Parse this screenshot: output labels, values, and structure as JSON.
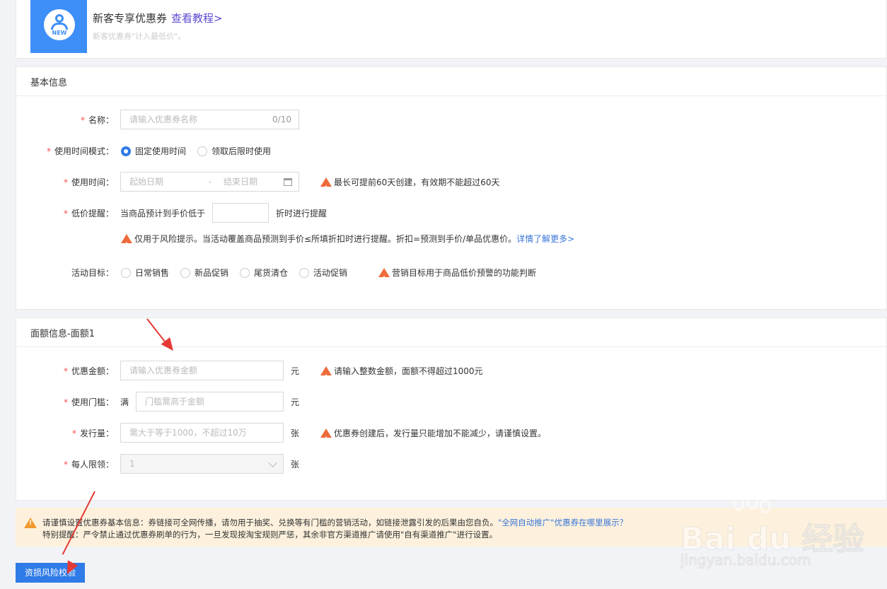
{
  "promo": {
    "badge_text": "NEW",
    "title": "新客专享优惠券",
    "tutorial_link": "查看教程>",
    "subtitle": "新客优惠券\"计入最低价\"。"
  },
  "basic": {
    "title": "基本信息",
    "name": {
      "label": "名称：",
      "placeholder": "请输入优惠券名称",
      "counter": "0/10"
    },
    "time_mode": {
      "label": "使用时间模式：",
      "options": [
        "固定使用时间",
        "领取后限时使用"
      ],
      "selected": "固定使用时间"
    },
    "use_time": {
      "label": "使用时间：",
      "start_placeholder": "起始日期",
      "separator": "-",
      "end_placeholder": "结束日期",
      "warning": "最长可提前60天创建，有效期不能超过60天"
    },
    "low_price": {
      "label": "低价提醒：",
      "prefix": "当商品预计到手价低于",
      "suffix": "折时进行提醒",
      "warning": "仅用于风险提示。当活动覆盖商品预测到手价≤所填折扣时进行提醒。折扣=预测到手价/单品优惠价。",
      "more_link": "详情了解更多>"
    },
    "goal": {
      "label": "活动目标：",
      "options": [
        "日常销售",
        "新品促销",
        "尾货清仓",
        "活动促销"
      ],
      "warning": "营销目标用于商品低价预警的功能判断"
    }
  },
  "amount": {
    "title": "面额信息-面额1",
    "discount": {
      "label": "优惠金额：",
      "placeholder": "请输入优惠券金额",
      "unit": "元",
      "warning": "请输入整数金额，面额不得超过1000元"
    },
    "threshold": {
      "label": "使用门槛：",
      "prefix": "满",
      "placeholder": "门槛需高于金额",
      "unit": "元"
    },
    "issue": {
      "label": "发行量：",
      "placeholder": "需大于等于1000，不超过10万",
      "unit": "张",
      "warning": "优惠券创建后，发行量只能增加不能减少，请谨慎设置。"
    },
    "limit": {
      "label": "每人限领：",
      "value": "1",
      "unit": "张"
    }
  },
  "notice": {
    "line1": "请谨慎设置优惠券基本信息：券链接可全网传播，请勿用于抽奖、兑换等有门槛的营销活动，如链接泄露引发的后果由您自负。",
    "line1_link": "\"全网自动推广\"优惠券在哪里展示？",
    "line2": "特别提醒：严令禁止通过优惠券刷单的行为，一旦发现按淘宝规则严惩，其余非官方渠道推广请使用\"自有渠道推广\"进行设置。"
  },
  "risk_button": "资损风险校验",
  "watermark": {
    "brand": "Bai du 经验",
    "url": "jingyan.baidu.com"
  },
  "colors": {
    "accent": "#2f7be8",
    "warning": "#ee6b3b",
    "required": "#ff4d4f",
    "notice_bg": "#fdf1dd",
    "annotation_arrow": "#e53935"
  }
}
